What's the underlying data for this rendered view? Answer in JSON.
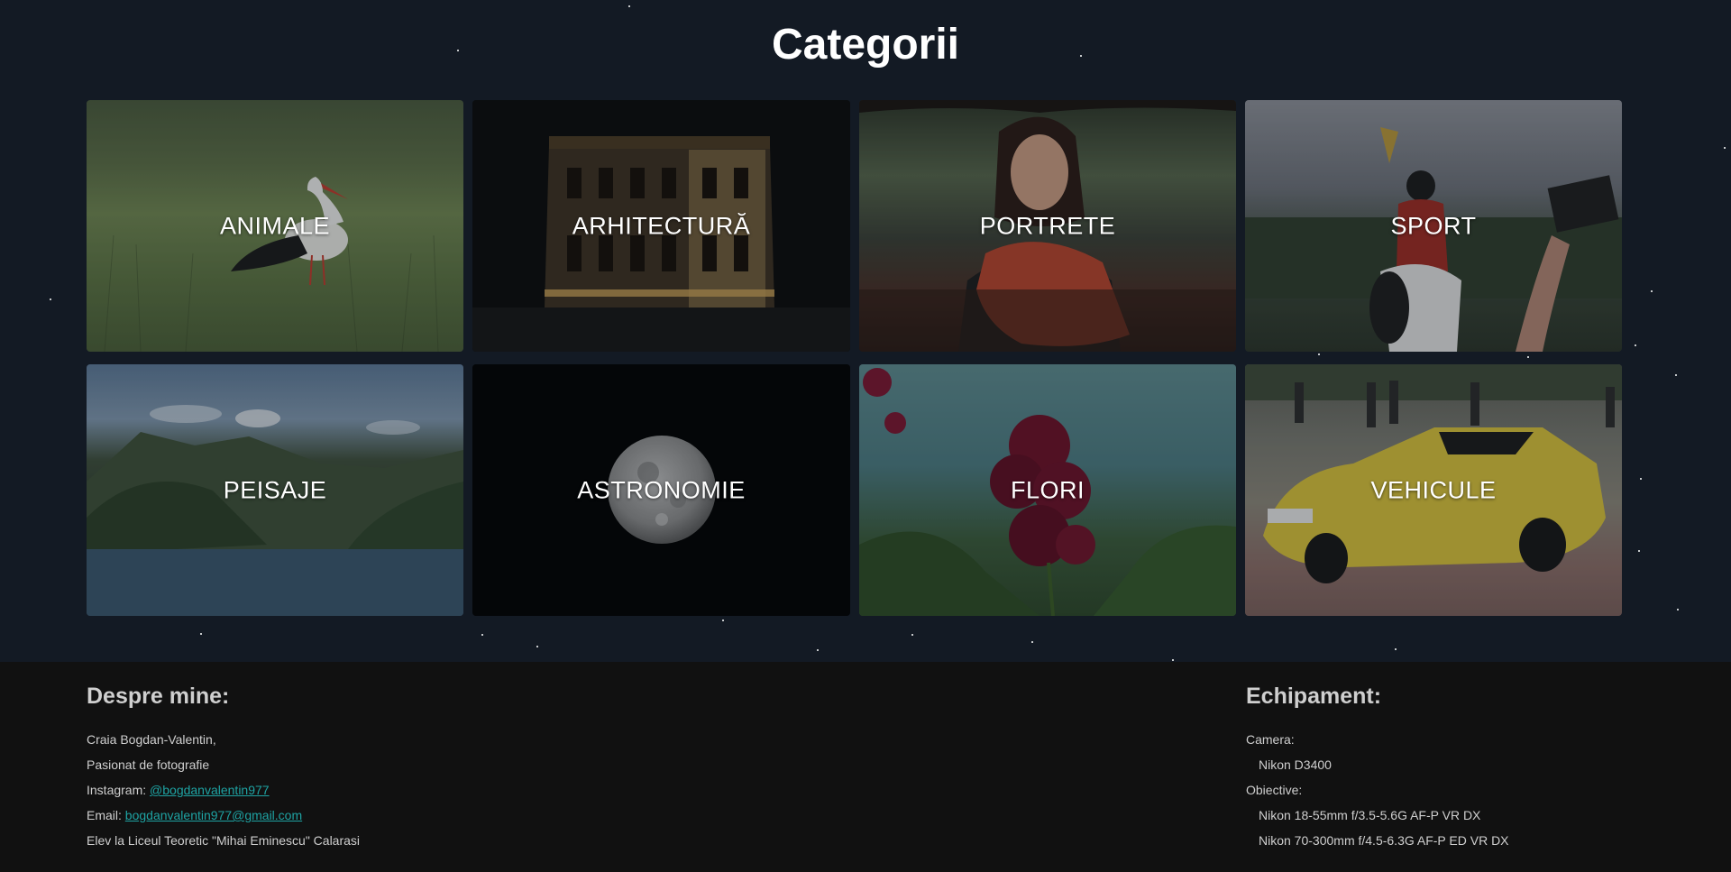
{
  "page": {
    "title": "Categorii"
  },
  "categories": [
    {
      "label": "ANIMALE"
    },
    {
      "label": "ARHITECTURĂ"
    },
    {
      "label": "PORTRETE"
    },
    {
      "label": "SPORT"
    },
    {
      "label": "PEISAJE"
    },
    {
      "label": "ASTRONOMIE"
    },
    {
      "label": "FLORI"
    },
    {
      "label": "VEHICULE"
    }
  ],
  "footer": {
    "about": {
      "heading": "Despre mine:",
      "name": "Craia Bogdan-Valentin,",
      "passion": "Pasionat de fotografie",
      "instagram_label": "Instagram:",
      "instagram_handle": "@bogdanvalentin977",
      "email_label": "Email:",
      "email": "bogdanvalentin977@gmail.com",
      "school": "Elev la Liceul Teoretic \"Mihai Eminescu\" Calarasi"
    },
    "equipment": {
      "heading": "Echipament:",
      "camera_label": "Camera:",
      "camera": "Nikon D3400",
      "lenses_label": "Obiective:",
      "lens_1": "Nikon 18-55mm f/3.5-5.6G AF-P VR DX",
      "lens_2": "Nikon 70-300mm f/4.5-6.3G AF-P ED VR DX"
    }
  },
  "colors": {
    "background": "#131a24",
    "footer_background": "#111111",
    "link": "#1ea3a3"
  }
}
